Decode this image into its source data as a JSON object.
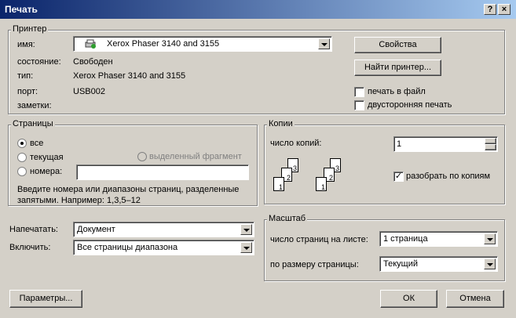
{
  "window": {
    "title": "Печать",
    "help_btn": "?",
    "close_btn": "×"
  },
  "printer": {
    "legend": "Принтер",
    "name_label": "имя:",
    "name_value": "Xerox Phaser 3140 and 3155",
    "status_label": "состояние:",
    "status_value": "Свободен",
    "type_label": "тип:",
    "type_value": "Xerox Phaser 3140 and 3155",
    "port_label": "порт:",
    "port_value": "USB002",
    "notes_label": "заметки:",
    "properties_button": "Свойства",
    "find_button": "Найти принтер...",
    "print_to_file": "печать в файл",
    "duplex": "двусторонняя печать"
  },
  "pages": {
    "legend": "Страницы",
    "all": "все",
    "current": "текущая",
    "selection": "выделенный фрагмент",
    "numbers": "номера:",
    "hint": "Введите номера или диапазоны страниц, разделенные запятыми. Например: 1,3,5–12"
  },
  "copies": {
    "legend": "Копии",
    "count_label": "число копий:",
    "count_value": "1",
    "collate": "разобрать по копиям",
    "page_labels": [
      "1",
      "2",
      "3"
    ]
  },
  "print_what": {
    "label": "Напечатать:",
    "value": "Документ"
  },
  "include": {
    "label": "Включить:",
    "value": "Все страницы диапазона"
  },
  "zoom": {
    "legend": "Масштаб",
    "pages_per_sheet_label": "число страниц на листе:",
    "pages_per_sheet_value": "1 страница",
    "scale_label": "по размеру страницы:",
    "scale_value": "Текущий"
  },
  "footer": {
    "options_button": "Параметры...",
    "ok_button": "ОК",
    "cancel_button": "Отмена"
  }
}
